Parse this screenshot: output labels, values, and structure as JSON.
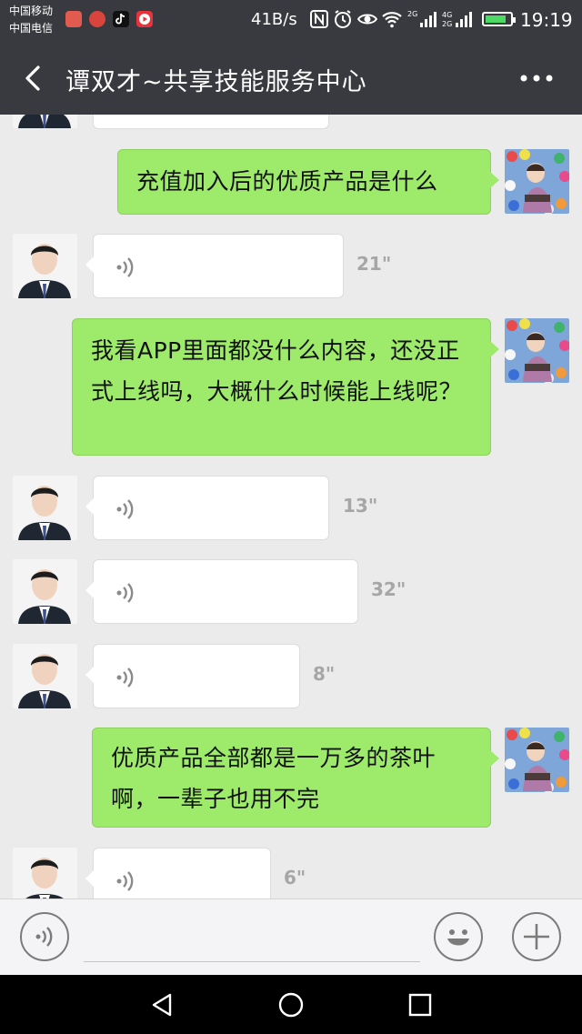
{
  "status_bar": {
    "carrier_1": "中国移动",
    "carrier_2": "中国电信",
    "net_speed": "41B/s",
    "signal_1": "2G",
    "signal_2": "4G 2G",
    "time": "19:19",
    "battery_level": 0.85
  },
  "header": {
    "title": "谭双才~共享技能服务中心"
  },
  "messages": [
    {
      "side": "left",
      "type": "voice-partial"
    },
    {
      "side": "right",
      "type": "text",
      "text": "充值加入后的优质产品是什么"
    },
    {
      "side": "left",
      "type": "voice",
      "duration": "21\""
    },
    {
      "side": "right",
      "type": "text",
      "text": "我看APP里面都没什么内容，还没正式上线吗，大概什么时候能上线呢？"
    },
    {
      "side": "left",
      "type": "voice",
      "duration": "13\""
    },
    {
      "side": "left",
      "type": "voice",
      "duration": "32\""
    },
    {
      "side": "left",
      "type": "voice",
      "duration": "8\""
    },
    {
      "side": "right",
      "type": "text",
      "text": "优质产品全部都是一万多的茶叶啊，一辈子也用不完"
    },
    {
      "side": "left",
      "type": "voice",
      "duration": "6\""
    }
  ],
  "icons": {
    "back": "chevron-left-icon",
    "more": "more-dots-icon",
    "voice": "voice-wave-icon",
    "emoji": "smiley-icon",
    "add": "plus-icon"
  },
  "colors": {
    "header_bg": "#393a3f",
    "chat_bg": "#ebebeb",
    "bubble_right": "#9eea6a",
    "bubble_left": "#ffffff"
  }
}
